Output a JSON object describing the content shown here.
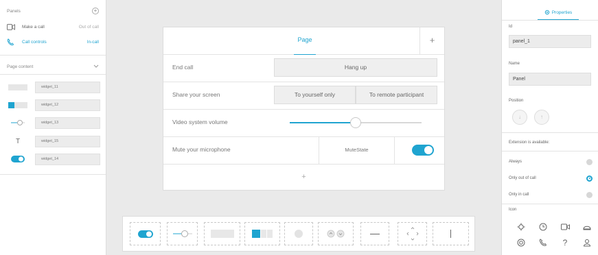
{
  "left_panel": {
    "panels_title": "Panels",
    "panels": [
      {
        "name": "Make a call",
        "status": "Out of call",
        "icon": "video-camera-icon"
      },
      {
        "name": "Call controls",
        "status": "In-call",
        "icon": "phone-icon"
      }
    ],
    "page_content_title": "Page content",
    "widgets": [
      {
        "name": "widget_11",
        "icon": "button-widget-icon"
      },
      {
        "name": "widget_12",
        "icon": "group-button-icon"
      },
      {
        "name": "widget_13",
        "icon": "slider-icon"
      },
      {
        "name": "widget_15",
        "icon": "text-icon"
      },
      {
        "name": "widget_14",
        "icon": "toggle-icon"
      }
    ]
  },
  "panel_editor": {
    "tab_label": "Page",
    "add_tab": "+",
    "rows": [
      {
        "label": "End call",
        "button": "Hang up"
      },
      {
        "label": "Share your screen",
        "options": [
          "To yourself only",
          "To remote participant"
        ]
      },
      {
        "label": "Video system volume",
        "slider_value": 0.5
      },
      {
        "label": "Mute your microphone",
        "state_text": "MuteState",
        "toggle_on": true
      }
    ],
    "add_row": "+"
  },
  "palette": {
    "items": [
      "toggle",
      "slider",
      "button",
      "group-button",
      "spinner",
      "slider-stepper",
      "divider",
      "directional-pad",
      "text"
    ]
  },
  "properties": {
    "tab_label": "Properties",
    "id_label": "Id",
    "id_value": "panel_1",
    "name_label": "Name",
    "name_value": "Panel",
    "position_label": "Position",
    "extension_label": "Extension is available:",
    "extension_options": [
      {
        "label": "Always",
        "selected": false
      },
      {
        "label": "Only out of call",
        "selected": true
      },
      {
        "label": "Only in call",
        "selected": false
      }
    ],
    "icon_label": "Icon",
    "accent_color": "#1fa4d0"
  }
}
